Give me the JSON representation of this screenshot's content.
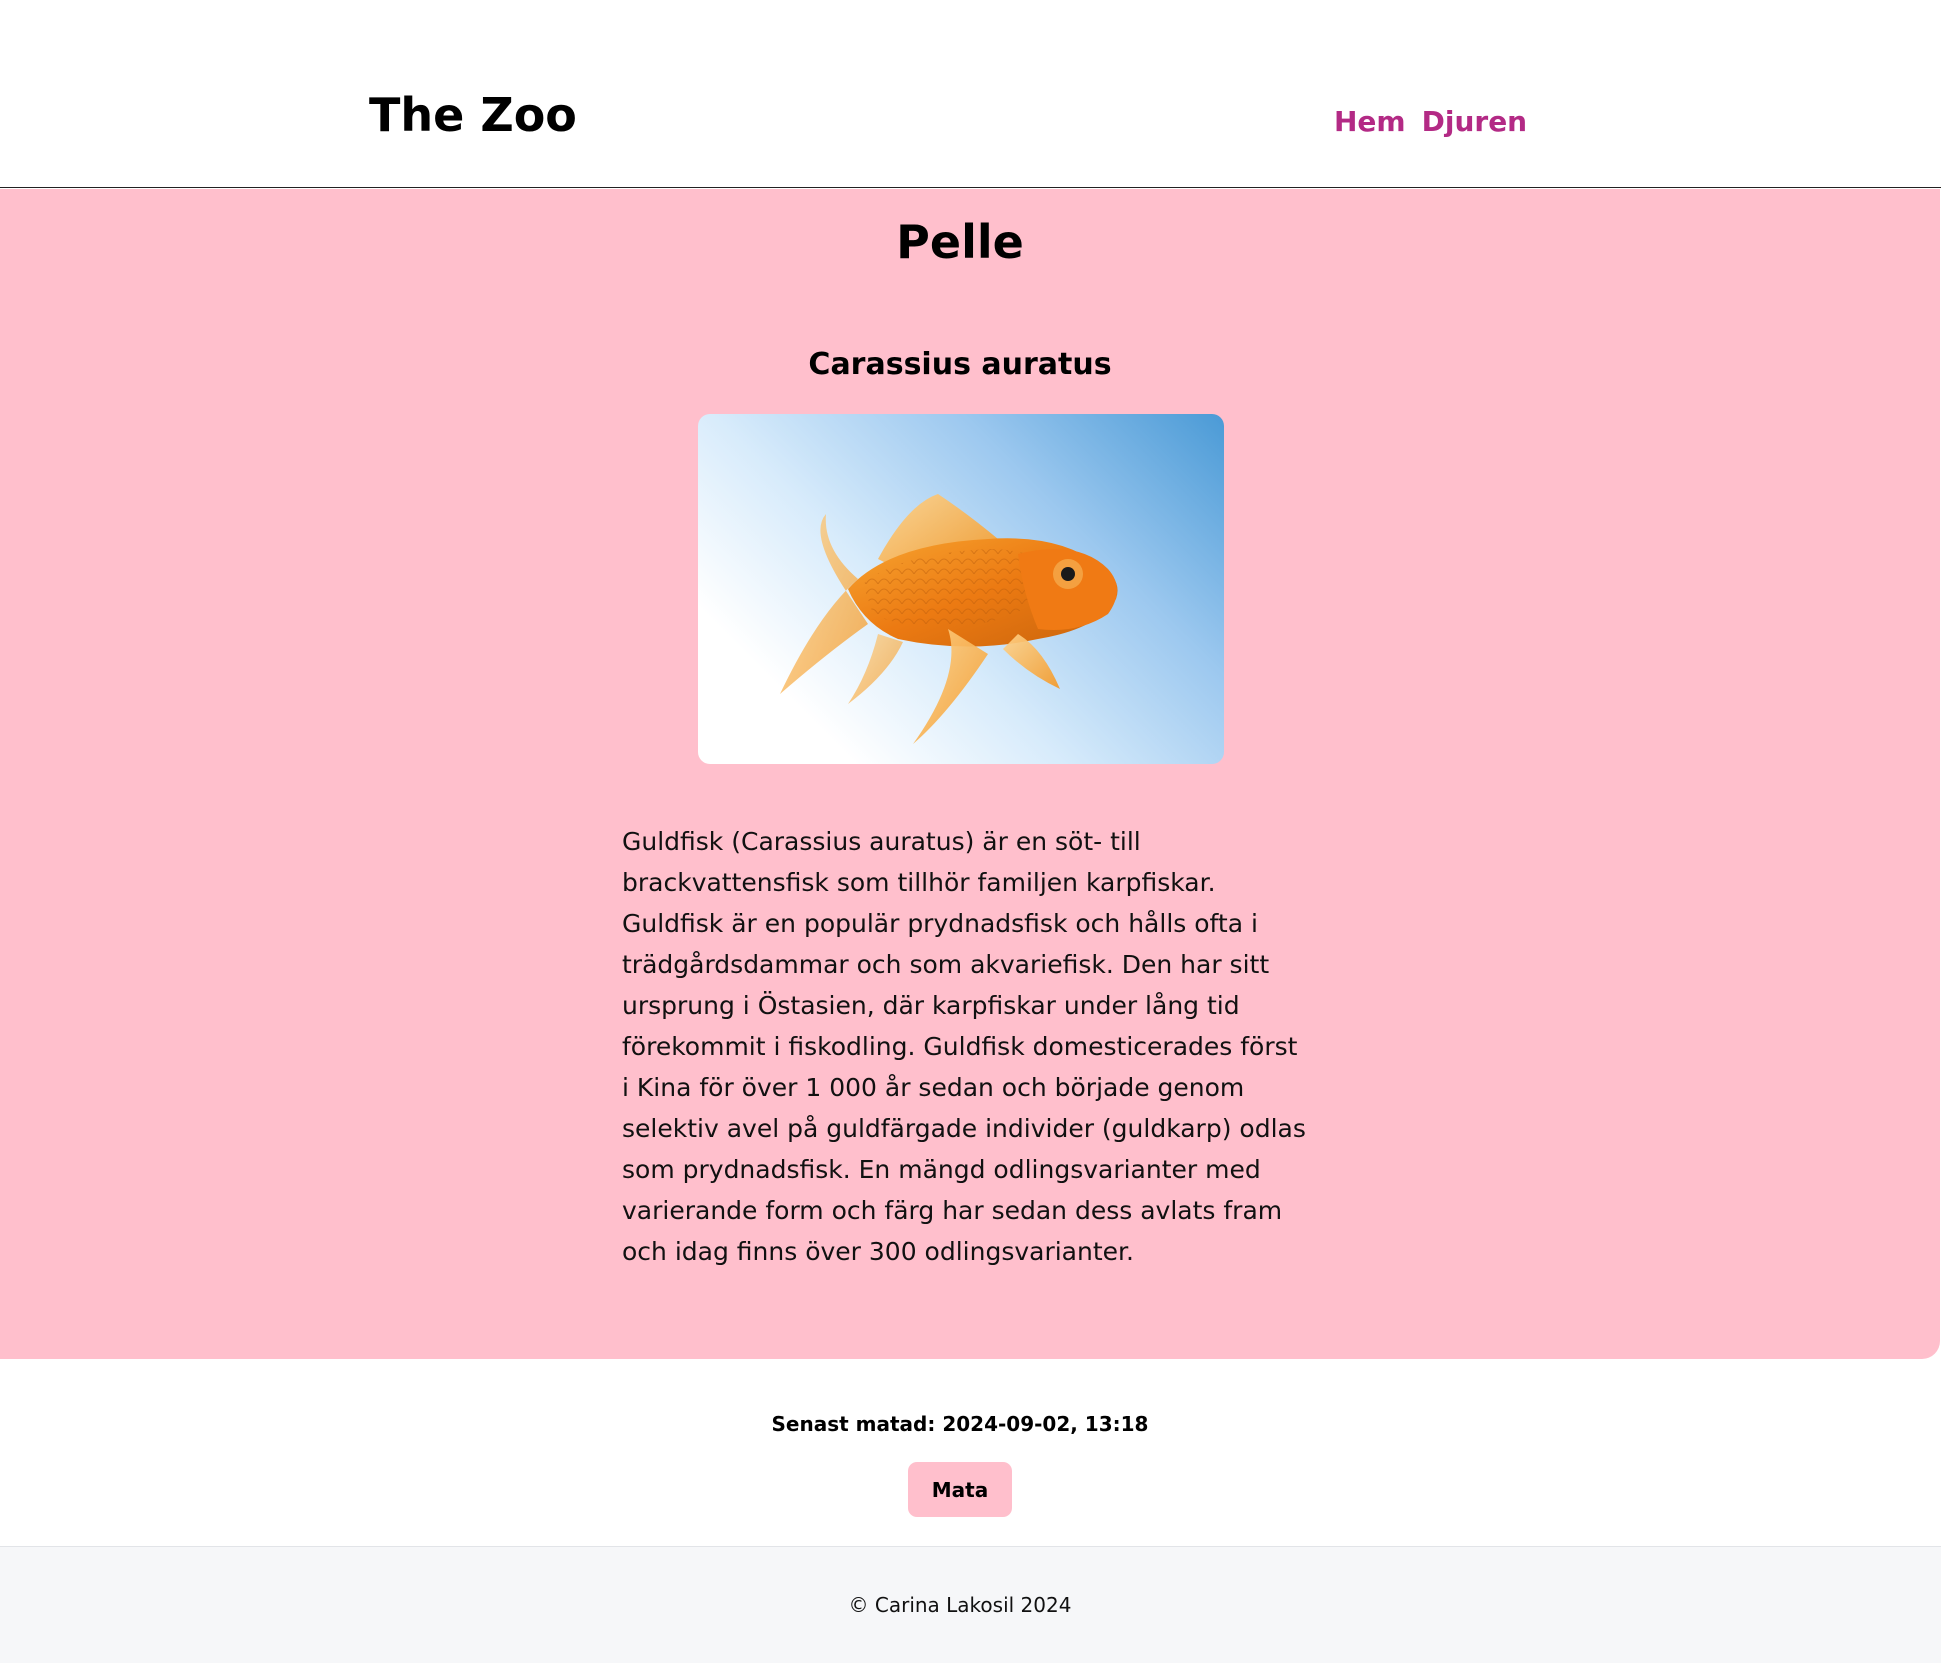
{
  "header": {
    "brand": "The Zoo",
    "nav": [
      {
        "label": "Hem"
      },
      {
        "label": "Djuren"
      }
    ],
    "link_color": "#b32a85"
  },
  "animal": {
    "name": "Pelle",
    "latin_name": "Carassius auratus",
    "image_alt": "goldfish",
    "description": "Guldfisk (Carassius auratus) är en söt- till brackvattensfisk som tillhör familjen karpfiskar. Guldfisk är en populär prydnadsfisk och hålls ofta i trädgårdsdammar och som akvariefisk. Den har sitt ursprung i Östasien, där karpfiskar under lång tid förekommit i fiskodling. Guldfisk domesticerades först i Kina för över 1 000 år sedan och började genom selektiv avel på guldfärgade individer (guldkarp) odlas som prydnadsfisk. En mängd odlingsvarianter med varierande form och färg har sedan dess avlats fram och idag finns över 300 odlingsvarianter."
  },
  "feeding": {
    "last_fed": "Senast matad: 2024-09-02, 13:18",
    "button_label": "Mata"
  },
  "footer": {
    "copyright": "© Carina Lakosil 2024"
  },
  "colors": {
    "main_bg": "#ffbfcc",
    "footer_bg": "#f6f7f9"
  }
}
